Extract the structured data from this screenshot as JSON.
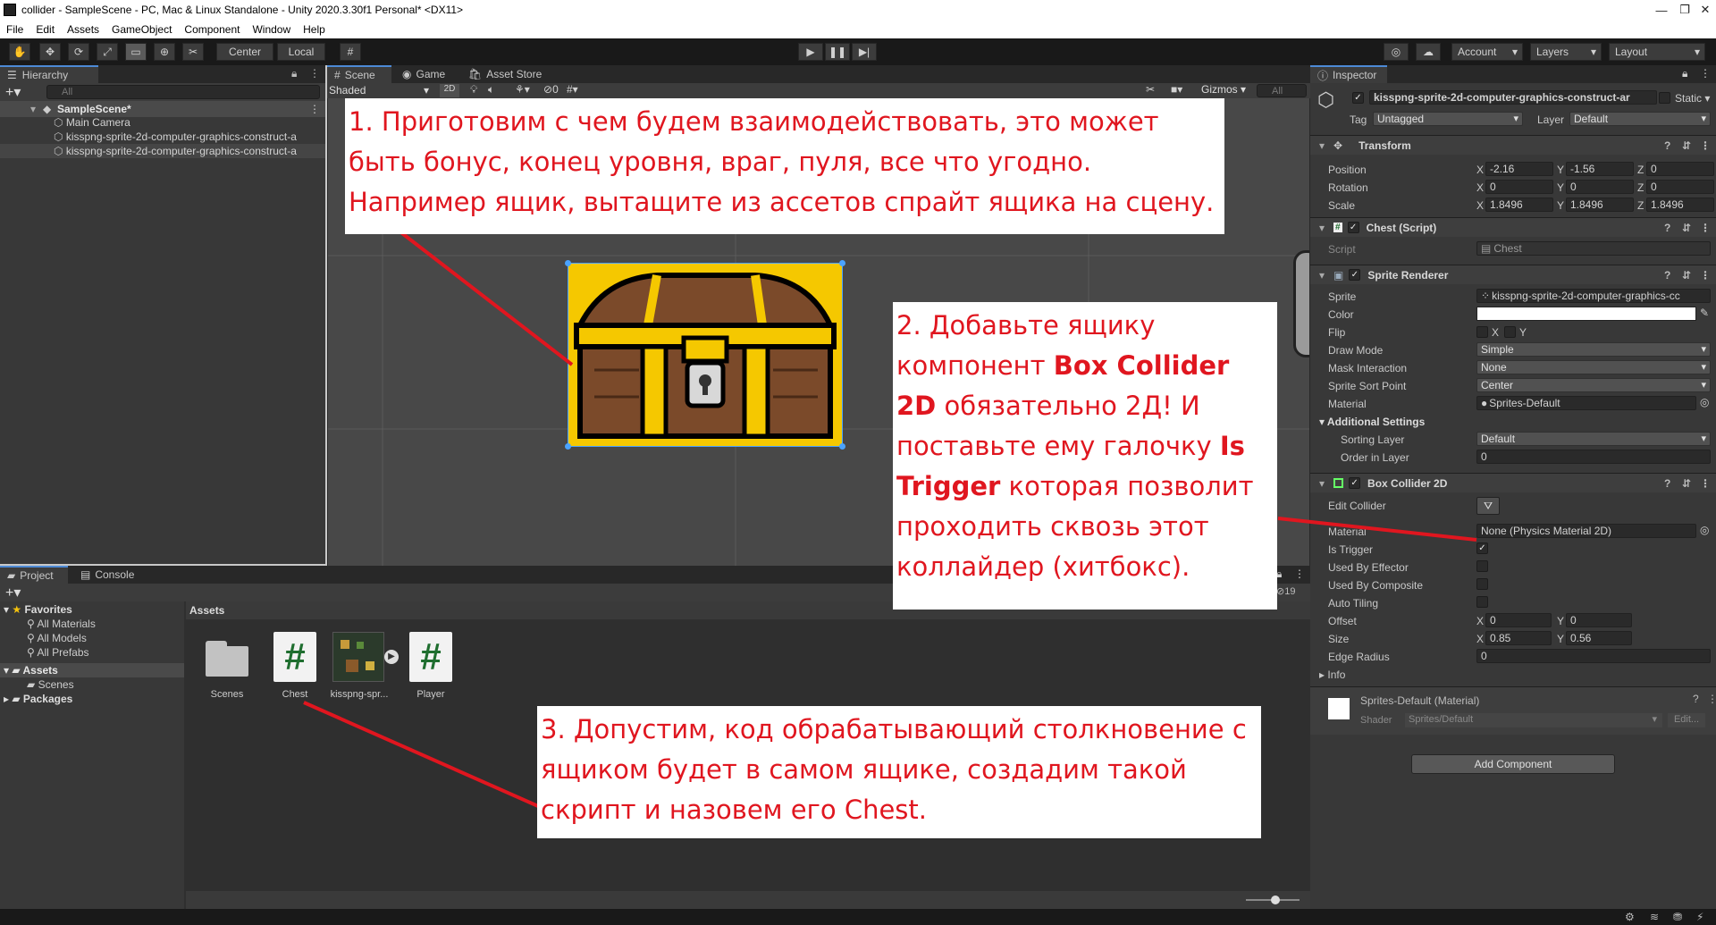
{
  "window": {
    "title": "collider - SampleScene - PC, Mac & Linux Standalone - Unity 2020.3.30f1 Personal* <DX11>"
  },
  "menu": [
    "File",
    "Edit",
    "Assets",
    "GameObject",
    "Component",
    "Window",
    "Help"
  ],
  "toolbar": {
    "center_label": "Center",
    "local_label": "Local",
    "account_label": "Account",
    "layers_label": "Layers",
    "layout_label": "Layout"
  },
  "hierarchy": {
    "tab": "Hierarchy",
    "search_placeholder": "All",
    "scene_name": "SampleScene*",
    "items": [
      "Main Camera",
      "kisspng-sprite-2d-computer-graphics-construct-a",
      "kisspng-sprite-2d-computer-graphics-construct-a"
    ]
  },
  "scene_view": {
    "tabs": [
      "Scene",
      "Game",
      "Asset Store"
    ],
    "shading": "Shaded",
    "mode_2d": "2D",
    "hidden_count": "0",
    "gizmos_label": "Gizmos",
    "search_placeholder": "All"
  },
  "project": {
    "tabs": [
      "Project",
      "Console"
    ],
    "favorites_label": "Favorites",
    "favorites": [
      "All Materials",
      "All Models",
      "All Prefabs"
    ],
    "assets_label": "Assets",
    "asset_folders": [
      "Scenes"
    ],
    "packages_label": "Packages",
    "breadcrumb": "Assets",
    "items": [
      "Scenes",
      "Chest",
      "kisspng-spr...",
      "Player"
    ],
    "item_count": "19"
  },
  "inspector": {
    "tab": "Inspector",
    "object_name": "kisspng-sprite-2d-computer-graphics-construct-ar",
    "static_label": "Static",
    "tag_label": "Tag",
    "tag_value": "Untagged",
    "layer_label": "Layer",
    "layer_value": "Default",
    "transform": {
      "title": "Transform",
      "rows": [
        {
          "label": "Position",
          "x": "-2.16",
          "y": "-1.56",
          "z": "0"
        },
        {
          "label": "Rotation",
          "x": "0",
          "y": "0",
          "z": "0"
        },
        {
          "label": "Scale",
          "x": "1.8496",
          "y": "1.8496",
          "z": "1.8496"
        }
      ]
    },
    "chest_script": {
      "title": "Chest (Script)",
      "script_label": "Script",
      "script_value": "Chest"
    },
    "sprite_renderer": {
      "title": "Sprite Renderer",
      "sprite_label": "Sprite",
      "sprite_value": "kisspng-sprite-2d-computer-graphics-cc",
      "color_label": "Color",
      "flip_label": "Flip",
      "flip_x": "X",
      "flip_y": "Y",
      "draw_mode_label": "Draw Mode",
      "draw_mode_value": "Simple",
      "mask_label": "Mask Interaction",
      "mask_value": "None",
      "sort_point_label": "Sprite Sort Point",
      "sort_point_value": "Center",
      "material_label": "Material",
      "material_value": "Sprites-Default",
      "additional_label": "Additional Settings",
      "sorting_layer_label": "Sorting Layer",
      "sorting_layer_value": "Default",
      "order_label": "Order in Layer",
      "order_value": "0"
    },
    "box_collider": {
      "title": "Box Collider 2D",
      "edit_label": "Edit Collider",
      "material_label": "Material",
      "material_value": "None (Physics Material 2D)",
      "is_trigger_label": "Is Trigger",
      "used_by_effector_label": "Used By Effector",
      "used_by_composite_label": "Used By Composite",
      "auto_tiling_label": "Auto Tiling",
      "offset_label": "Offset",
      "offset_x": "0",
      "offset_y": "0",
      "size_label": "Size",
      "size_x": "0.85",
      "size_y": "0.56",
      "edge_radius_label": "Edge Radius",
      "edge_radius_value": "0",
      "info_label": "Info"
    },
    "material_block": {
      "title": "Sprites-Default (Material)",
      "shader_label": "Shader",
      "shader_value": "Sprites/Default",
      "edit_label": "Edit..."
    },
    "add_component_label": "Add Component"
  },
  "annotations": {
    "note1": "1. Приготовим с чем будем взаимодействовать, это может быть бонус, конец уровня, враг, пуля, все что угодно. Например ящик, вытащите из ассетов спрайт ящика на сцену.",
    "note2_a": "2. Добавьте ящику компонент ",
    "note2_b": "Box Collider 2D",
    "note2_c": " обязательно 2Д! И поставьте ему галочку ",
    "note2_d": "Is Trigger",
    "note2_e": " которая позволит проходить сквозь этот коллайдер (хитбокс).",
    "note3": "3. Допустим, код обрабатывающий столкновение с ящиком будет в самом ящике, создадим такой скрипт и назовем его Chest."
  },
  "colors": {
    "annotation_red": "#e0161f",
    "accent_blue": "#4d8ad6",
    "script_green": "#1f6e2f"
  }
}
